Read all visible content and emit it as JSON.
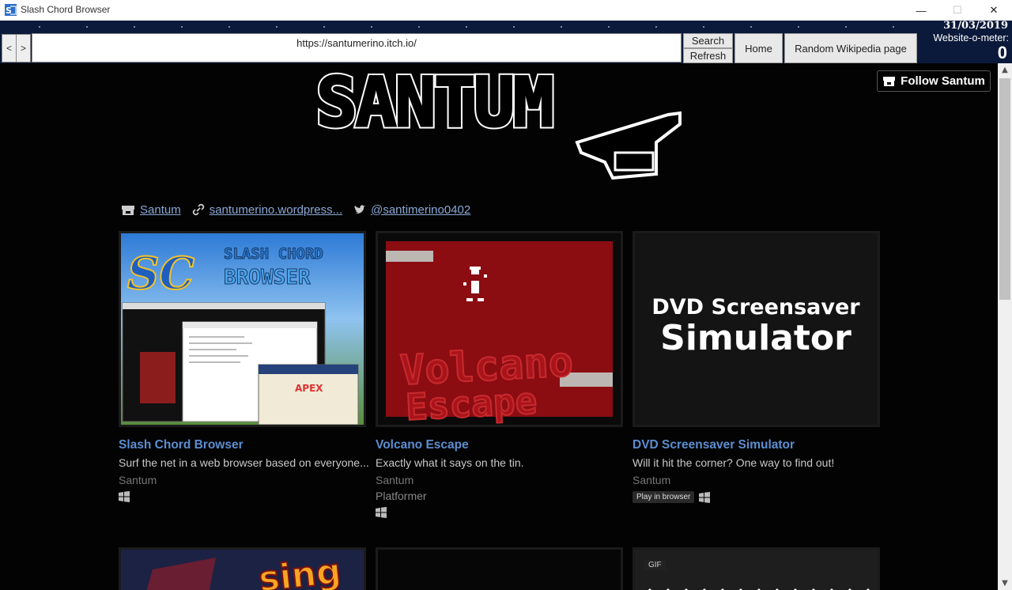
{
  "window": {
    "title": "Slash Chord Browser"
  },
  "toolbar": {
    "back_label": "<",
    "forward_label": ">",
    "url": "https://santumerino.itch.io/",
    "search_label": "Search",
    "refresh_label": "Refresh",
    "home_label": "Home",
    "random_label": "Random Wikipedia page",
    "date": "31/03/2019",
    "meter_label": "Website-o-meter:",
    "meter_value": "0"
  },
  "page": {
    "logo_text": "SANTUM",
    "follow_label": "Follow Santum",
    "links": [
      {
        "icon": "itchio-icon",
        "text": "Santum"
      },
      {
        "icon": "link-icon",
        "text": "santumerino.wordpress..."
      },
      {
        "icon": "twitter-icon",
        "text": "@santimerino0402"
      }
    ],
    "games": [
      {
        "title": "Slash Chord Browser",
        "description": "Surf the net in a web browser based on everyone...",
        "author": "Santum",
        "genre": "",
        "platforms": [
          "windows-icon"
        ],
        "badge": "",
        "thumb_title_1": "SLASH CHORD",
        "thumb_title_2": "BROWSER"
      },
      {
        "title": "Volcano Escape",
        "description": "Exactly what it says on the tin.",
        "author": "Santum",
        "genre": "Platformer",
        "platforms": [
          "windows-icon"
        ],
        "badge": "",
        "thumb_title_1": "Volcano",
        "thumb_title_2": "Escape"
      },
      {
        "title": "DVD Screensaver Simulator",
        "description": "Will it hit the corner? One way to find out!",
        "author": "Santum",
        "genre": "",
        "platforms": [
          "windows-icon"
        ],
        "badge": "Play in browser",
        "thumb_title_1": "DVD Screensaver",
        "thumb_title_2": "Simulator"
      }
    ],
    "bottom_row": {
      "partial_text": "sing",
      "gif_badge": "GIF"
    }
  },
  "colors": {
    "toolbar_bg": "#0b1a3a",
    "link": "#8aa9d6",
    "game_title": "#5c8ed1",
    "page_bg": "#030303"
  }
}
